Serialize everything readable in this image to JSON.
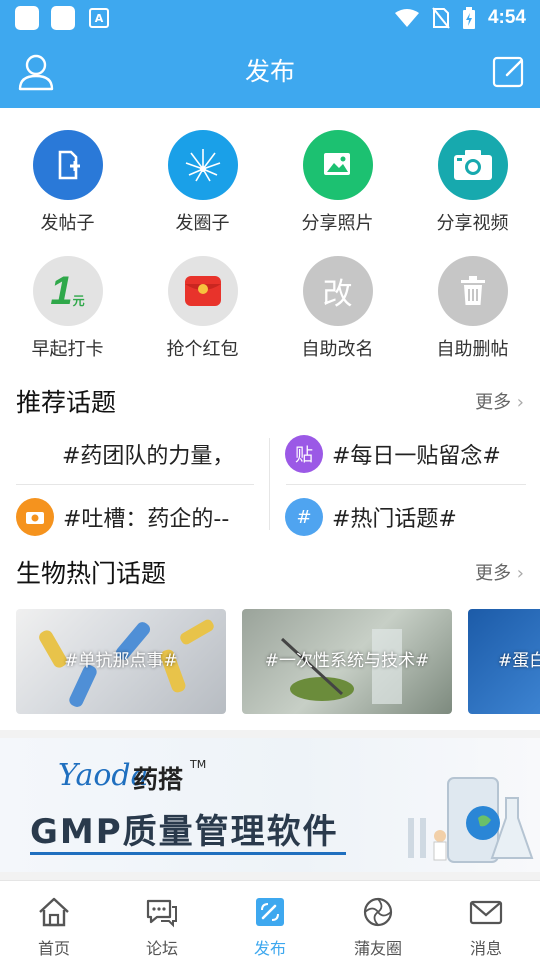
{
  "status_bar": {
    "time": "4:54",
    "a_icon": "A"
  },
  "header": {
    "title": "发布"
  },
  "actions": [
    {
      "label": "发帖子",
      "icon": "new-post-icon",
      "color": "#2a79d8"
    },
    {
      "label": "发圈子",
      "icon": "circle-icon",
      "color": "#1aa0e8"
    },
    {
      "label": "分享照片",
      "icon": "photo-icon",
      "color": "#1cc171"
    },
    {
      "label": "分享视频",
      "icon": "camera-icon",
      "color": "#17a9ae"
    },
    {
      "label": "早起打卡",
      "icon": "checkin-icon",
      "color": "#e3e3e3",
      "glyph": "1",
      "glyph_sub": "元"
    },
    {
      "label": "抢个红包",
      "icon": "red-envelope-icon",
      "color": "#e3e3e3"
    },
    {
      "label": "自助改名",
      "icon": "rename-icon",
      "color": "#c6c6c6",
      "glyph": "改"
    },
    {
      "label": "自助删帖",
      "icon": "trash-icon",
      "color": "#c6c6c6"
    }
  ],
  "recommended": {
    "title": "推荐话题",
    "more": "更多",
    "topics": [
      {
        "text": "#药团队的力量，",
        "icon": ""
      },
      {
        "text": "#每日一贴留念#",
        "icon": "贴",
        "color": "#9b59e6"
      },
      {
        "text": "#吐槽：药企的--",
        "icon": "camera",
        "color": "#f5931e"
      },
      {
        "text": "#热门话题#",
        "icon": "#",
        "color": "#4fa4f0"
      }
    ]
  },
  "bio": {
    "title": "生物热门话题",
    "more": "更多",
    "cards": [
      {
        "title": "#单抗那点事#"
      },
      {
        "title": "#一次性系统与技术#"
      },
      {
        "title": "#蛋白"
      }
    ]
  },
  "banner": {
    "logo": "Yaoda",
    "brand": "药搭",
    "tm": "TM",
    "text": "GMP质量管理软件"
  },
  "tabs": [
    {
      "label": "首页",
      "icon": "home-icon",
      "active": false
    },
    {
      "label": "论坛",
      "icon": "forum-icon",
      "active": false
    },
    {
      "label": "发布",
      "icon": "publish-icon",
      "active": true
    },
    {
      "label": "蒲友圈",
      "icon": "friends-circle-icon",
      "active": false
    },
    {
      "label": "消息",
      "icon": "mail-icon",
      "active": false
    }
  ],
  "colors": {
    "primary": "#3ea8ef"
  }
}
